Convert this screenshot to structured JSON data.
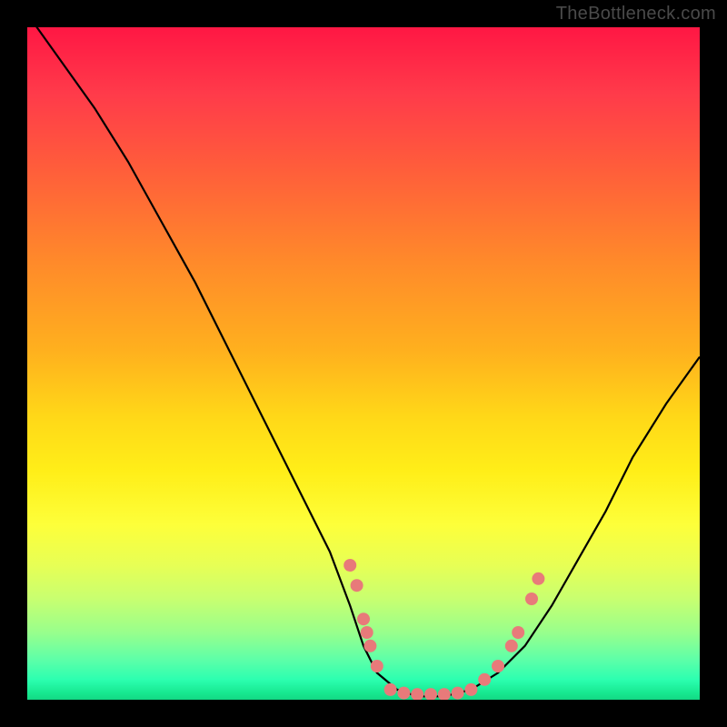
{
  "watermark": "TheBottleneck.com",
  "chart_data": {
    "type": "line",
    "title": "",
    "xlabel": "",
    "ylabel": "",
    "xlim": [
      0,
      100
    ],
    "ylim": [
      0,
      100
    ],
    "curve": [
      {
        "x": 0,
        "y": 102
      },
      {
        "x": 5,
        "y": 95
      },
      {
        "x": 10,
        "y": 88
      },
      {
        "x": 15,
        "y": 80
      },
      {
        "x": 20,
        "y": 71
      },
      {
        "x": 25,
        "y": 62
      },
      {
        "x": 30,
        "y": 52
      },
      {
        "x": 35,
        "y": 42
      },
      {
        "x": 40,
        "y": 32
      },
      {
        "x": 45,
        "y": 22
      },
      {
        "x": 48,
        "y": 14
      },
      {
        "x": 50,
        "y": 8
      },
      {
        "x": 52,
        "y": 4
      },
      {
        "x": 55,
        "y": 1.5
      },
      {
        "x": 58,
        "y": 0.5
      },
      {
        "x": 62,
        "y": 0.5
      },
      {
        "x": 66,
        "y": 1.5
      },
      {
        "x": 70,
        "y": 4
      },
      {
        "x": 74,
        "y": 8
      },
      {
        "x": 78,
        "y": 14
      },
      {
        "x": 82,
        "y": 21
      },
      {
        "x": 86,
        "y": 28
      },
      {
        "x": 90,
        "y": 36
      },
      {
        "x": 95,
        "y": 44
      },
      {
        "x": 100,
        "y": 51
      }
    ],
    "markers": [
      {
        "x": 48,
        "y": 20
      },
      {
        "x": 49,
        "y": 17
      },
      {
        "x": 50,
        "y": 12
      },
      {
        "x": 50.5,
        "y": 10
      },
      {
        "x": 51,
        "y": 8
      },
      {
        "x": 52,
        "y": 5
      },
      {
        "x": 54,
        "y": 1.5
      },
      {
        "x": 56,
        "y": 1
      },
      {
        "x": 58,
        "y": 0.8
      },
      {
        "x": 60,
        "y": 0.8
      },
      {
        "x": 62,
        "y": 0.8
      },
      {
        "x": 64,
        "y": 1
      },
      {
        "x": 66,
        "y": 1.5
      },
      {
        "x": 68,
        "y": 3
      },
      {
        "x": 70,
        "y": 5
      },
      {
        "x": 72,
        "y": 8
      },
      {
        "x": 73,
        "y": 10
      },
      {
        "x": 75,
        "y": 15
      },
      {
        "x": 76,
        "y": 18
      }
    ],
    "marker_color": "#e87a7a",
    "curve_color": "#000000"
  }
}
